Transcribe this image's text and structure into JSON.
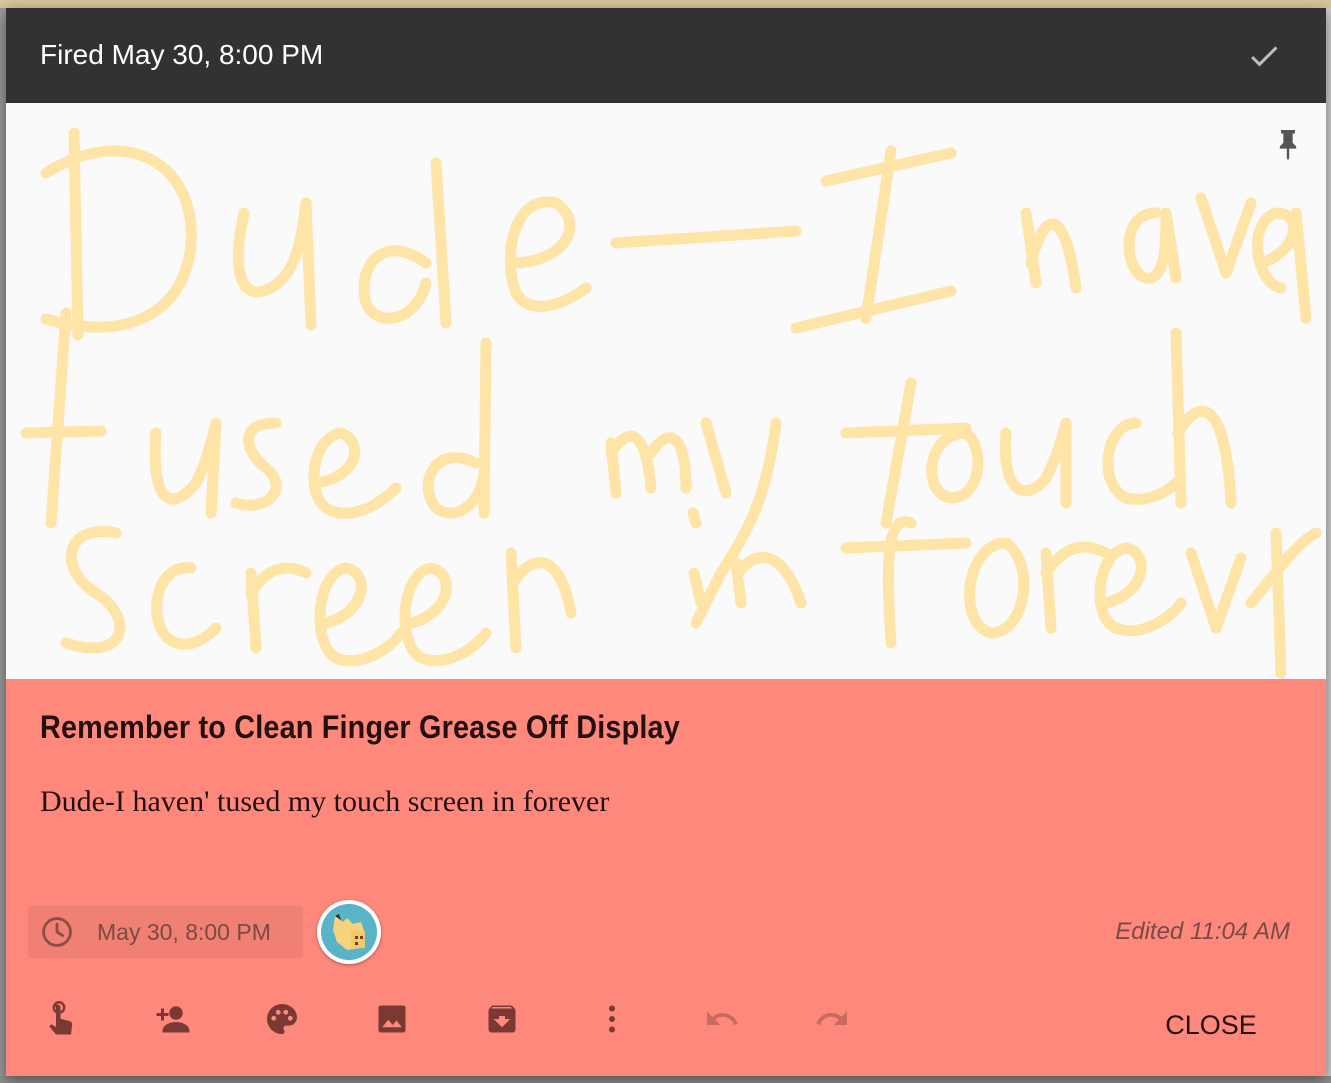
{
  "banner": {
    "fired_text": "Fired May 30, 8:00 PM",
    "done_icon": "check-icon"
  },
  "drawing": {
    "handwriting_lines": [
      "Dude-I haven'",
      "tused my touch",
      "screen in forev"
    ],
    "stroke_color": "#ffe3a3",
    "pin_icon": "pin-icon"
  },
  "note": {
    "background_color": "#ff887c",
    "title": "Remember to Clean Finger Grease Off Display",
    "body": "Dude-I haven' tused my touch screen in forever",
    "reminder_chip": {
      "icon": "clock-icon",
      "label": "May 30, 8:00 PM"
    },
    "collaborator_avatar": "avatar-icon",
    "edited_text": "Edited 11:04 AM"
  },
  "toolbar": {
    "items": [
      {
        "name": "pen-touch-button",
        "icon": "touch-pen-icon"
      },
      {
        "name": "collaborator-button",
        "icon": "person-add-icon"
      },
      {
        "name": "change-color-button",
        "icon": "palette-icon"
      },
      {
        "name": "add-image-button",
        "icon": "image-icon"
      },
      {
        "name": "archive-button",
        "icon": "archive-icon"
      },
      {
        "name": "more-button",
        "icon": "more-vert-icon"
      },
      {
        "name": "undo-button",
        "icon": "undo-icon"
      },
      {
        "name": "redo-button",
        "icon": "redo-icon"
      }
    ],
    "close_label": "CLOSE"
  }
}
